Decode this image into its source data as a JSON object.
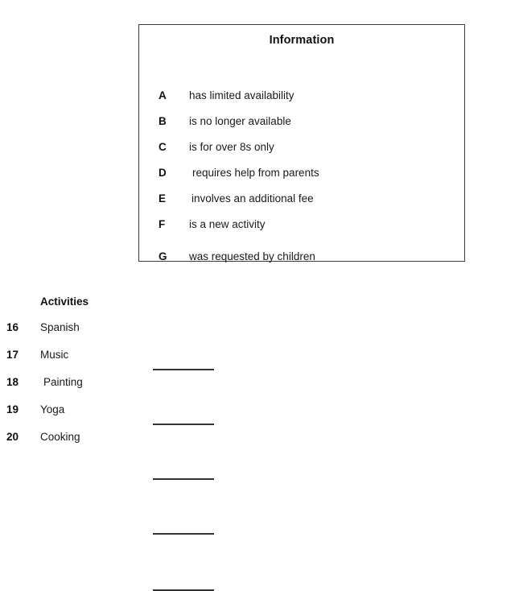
{
  "information_box": {
    "title": "Information",
    "options": [
      {
        "letter": "A",
        "text": "has limited availability"
      },
      {
        "letter": "B",
        "text": "is no longer available"
      },
      {
        "letter": "C",
        "text": "is for over 8s only"
      },
      {
        "letter": "D",
        "text": "requires help from parents"
      },
      {
        "letter": "E",
        "text": "involves an additional fee"
      },
      {
        "letter": "F",
        "text": "is a new activity"
      },
      {
        "letter": "G",
        "text": "was requested by children"
      }
    ]
  },
  "activities": {
    "heading": "Activities",
    "items": [
      {
        "number": "16",
        "label": "Spanish",
        "answer": ""
      },
      {
        "number": "17",
        "label": "Music",
        "answer": ""
      },
      {
        "number": "18",
        "label": "Painting",
        "answer": ""
      },
      {
        "number": "19",
        "label": "Yoga",
        "answer": ""
      },
      {
        "number": "20",
        "label": "Cooking",
        "answer": ""
      }
    ]
  },
  "colors": {
    "text": "#1a1a1a",
    "border": "#3c3c3c",
    "answer_line": "#333333",
    "background": "#ffffff"
  }
}
